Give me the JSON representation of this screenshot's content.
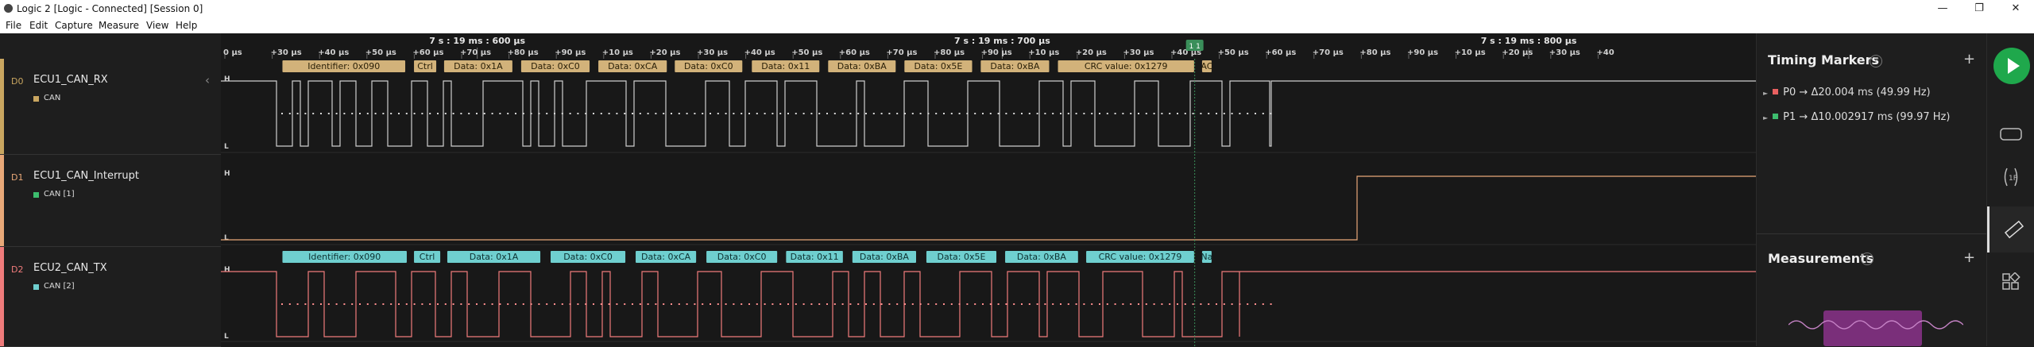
{
  "window": {
    "title": "Logic 2 [Logic - Connected] [Session 0]",
    "controls": [
      "—",
      "❐",
      "✕"
    ]
  },
  "menu": [
    "File",
    "Edit",
    "Capture",
    "Measure",
    "View",
    "Help"
  ],
  "channels": [
    {
      "id": "D0",
      "name": "ECU1_CAN_RX",
      "analyzer": "CAN",
      "color": "#c9a660",
      "hl": [
        "H",
        "L"
      ]
    },
    {
      "id": "D1",
      "name": "ECU1_CAN_Interrupt",
      "analyzer": "CAN [1]",
      "color": "#e8a878",
      "hl": [
        "H",
        "L"
      ]
    },
    {
      "id": "D2",
      "name": "ECU2_CAN_TX",
      "analyzer": "CAN [2]",
      "color": "#f07b7b",
      "hl": [
        "H",
        "L"
      ]
    }
  ],
  "ruler": {
    "major": [
      {
        "label": "7 s : 19 ms : 600 µs",
        "pos": 0.167
      },
      {
        "label": "7 s : 19 ms : 700 µs",
        "pos": 0.509
      },
      {
        "label": "7 s : 19 ms : 800 µs",
        "pos": 0.852
      }
    ],
    "minor": [
      "0 µs",
      "+30 µs",
      "+40 µs",
      "+50 µs",
      "+60 µs",
      "+70 µs",
      "+80 µs",
      "+90 µs",
      "+10 µs",
      "+20 µs",
      "+30 µs",
      "+40 µs",
      "+50 µs",
      "+60 µs",
      "+70 µs",
      "+80 µs",
      "+90 µs",
      "+10 µs",
      "+20 µs",
      "+30 µs",
      "+40 µs",
      "+50 µs",
      "+60 µs",
      "+70 µs",
      "+80 µs",
      "+90 µs",
      "+10 µs",
      "+20 µs",
      "+30 µs",
      "+40"
    ],
    "marker_badge": "1 1"
  },
  "frames_rx": {
    "fill": "#d2b27a",
    "text_color": "#2a2008",
    "segments": [
      {
        "label": "Identifier: 0x090",
        "start": 0.0401,
        "end": 0.1201
      },
      {
        "label": "Ctrl",
        "start": 0.1258,
        "end": 0.1403
      },
      {
        "label": "Data: 0x1A",
        "start": 0.1454,
        "end": 0.1899
      },
      {
        "label": "Data: 0xC0",
        "start": 0.1956,
        "end": 0.2402
      },
      {
        "label": "Data: 0xCA",
        "start": 0.2459,
        "end": 0.2905
      },
      {
        "label": "Data: 0xC0",
        "start": 0.2957,
        "end": 0.3397
      },
      {
        "label": "Data: 0x11",
        "start": 0.3459,
        "end": 0.3899
      },
      {
        "label": "Data: 0xBA",
        "start": 0.3956,
        "end": 0.4396
      },
      {
        "label": "Data: 0x5E",
        "start": 0.4453,
        "end": 0.4894
      },
      {
        "label": "Data: 0xBA",
        "start": 0.495,
        "end": 0.5396
      },
      {
        "label": "CRC value: 0x1279",
        "start": 0.5453,
        "end": 0.634
      },
      {
        "label": "AC",
        "start": 0.6392,
        "end": 0.6454
      }
    ]
  },
  "frames_tx": {
    "fill": "#6fcfcf",
    "text_color": "#0d3030",
    "segments": [
      {
        "label": "Identifier: 0x090",
        "start": 0.0401,
        "end": 0.1211
      },
      {
        "label": "Ctrl",
        "start": 0.1258,
        "end": 0.1429
      },
      {
        "label": "Data: 0x1A",
        "start": 0.1475,
        "end": 0.2081
      },
      {
        "label": "Data: 0xC0",
        "start": 0.2148,
        "end": 0.2635
      },
      {
        "label": "Data: 0xCA",
        "start": 0.2702,
        "end": 0.3096
      },
      {
        "label": "Data: 0xC0",
        "start": 0.3163,
        "end": 0.3624
      },
      {
        "label": "Data: 0x11",
        "start": 0.3682,
        "end": 0.4052
      },
      {
        "label": "Data: 0xBA",
        "start": 0.4114,
        "end": 0.4529
      },
      {
        "label": "Data: 0x5E",
        "start": 0.4596,
        "end": 0.5052
      },
      {
        "label": "Data: 0xBA",
        "start": 0.5109,
        "end": 0.5584
      },
      {
        "label": "CRC value: 0x1279",
        "start": 0.5637,
        "end": 0.634
      },
      {
        "label": "Na",
        "start": 0.6392,
        "end": 0.6454
      }
    ]
  },
  "timing_markers": {
    "title": "Timing Markers",
    "items": [
      {
        "name": "P0",
        "value": "Δ20.004 ms (49.99 Hz)",
        "color": "#e86060"
      },
      {
        "name": "P1",
        "value": "Δ10.002917 ms (99.97 Hz)",
        "color": "#3dbd6e"
      }
    ]
  },
  "measurements": {
    "title": "Measurements"
  },
  "colors": {
    "rx_line": "#cfcfcf",
    "int_line": "#e8a878",
    "tx_line": "#f07b7b",
    "dots_rx": "#d8d8d8",
    "dots_tx": "#ff8f8f",
    "play": "#1fa84c",
    "thumb": "#7a2f7a"
  },
  "icons": [
    "app-icon",
    "collapse-chevron-icon",
    "help-icon",
    "add-icon",
    "play-icon",
    "analyzer-icon",
    "trigger-icon",
    "ruler-icon",
    "extensions-icon",
    "measurement-thumbnail-icon"
  ]
}
